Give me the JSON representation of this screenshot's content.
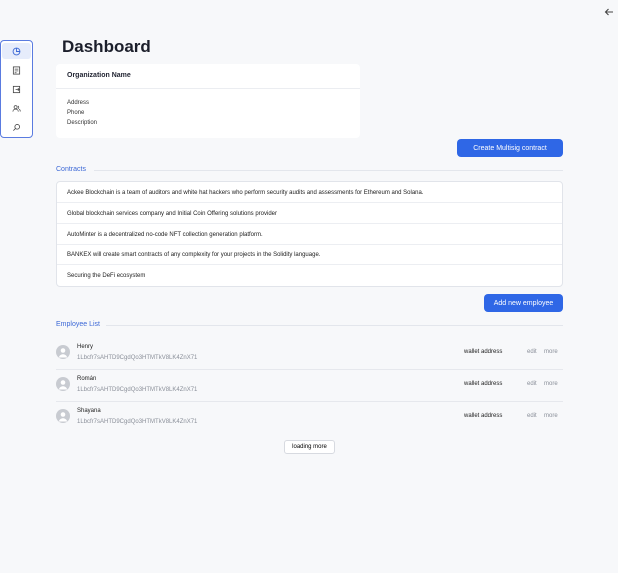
{
  "header": {
    "back_icon": "arrow-left-icon"
  },
  "sidebar": {
    "items": [
      {
        "icon": "pie-chart-icon",
        "active": true
      },
      {
        "icon": "document-icon",
        "active": false
      },
      {
        "icon": "logout-box-icon",
        "active": false
      },
      {
        "icon": "users-icon",
        "active": false
      },
      {
        "icon": "search-icon",
        "active": false
      }
    ],
    "accent_color": "#5a7be0"
  },
  "page": {
    "title": "Dashboard"
  },
  "organization": {
    "name": "Organization Name",
    "address_label": "Address",
    "phone_label": "Phone",
    "description_label": "Description"
  },
  "actions": {
    "create_multisig": "Create Multisig contract",
    "add_employee": "Add new employee",
    "load_more": "loading more"
  },
  "contracts": {
    "title": "Contracts",
    "items": [
      "Ackee Blockchain is a team of auditors and white hat hackers who perform security audits and assessments for Ethereum and Solana.",
      "Global blockchain services company and Initial Coin Offering solutions provider",
      "AutoMinter is a decentralized no-code NFT collection generation platform.",
      "BANKEX will create smart contracts of any complexity for your projects in the Solidity language.",
      "Securing the DeFi ecosystem"
    ]
  },
  "employees": {
    "title": "Employee List",
    "items": [
      {
        "name": "Henry",
        "wallet": "1Lbcfr7sAHTD9CgdQo3HTMTkV8LK4ZnX71",
        "wallet_label": "wallet address",
        "edit": "edit",
        "more": "more"
      },
      {
        "name": "Román",
        "wallet": "1Lbcfr7sAHTD9CgdQo3HTMTkV8LK4ZnX71",
        "wallet_label": "wallet address",
        "edit": "edit",
        "more": "more"
      },
      {
        "name": "Shayana",
        "wallet": "1Lbcfr7sAHTD9CgdQo3HTMTkV8LK4ZnX71",
        "wallet_label": "wallet address",
        "edit": "edit",
        "more": "more"
      }
    ]
  },
  "colors": {
    "primary": "#2f67e6",
    "section_title": "#3c68d6",
    "background": "#f7f8fa"
  }
}
